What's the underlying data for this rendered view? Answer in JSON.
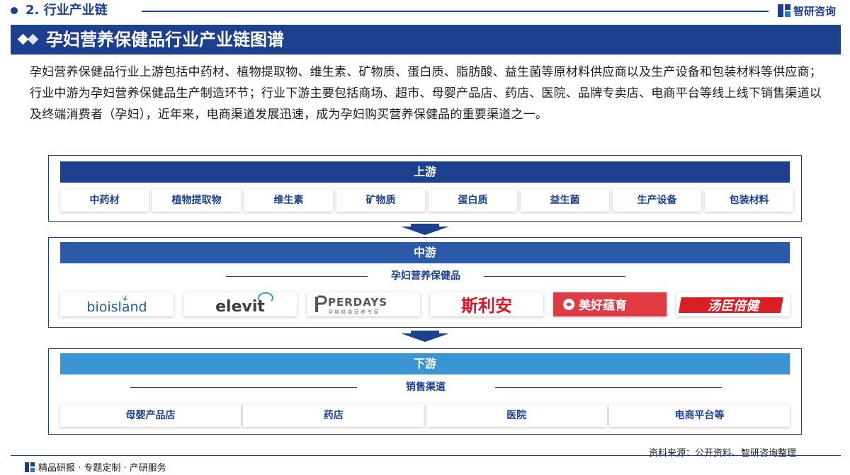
{
  "section": {
    "title": "2. 行业产业链"
  },
  "brand": {
    "name": "智研咨询"
  },
  "title": "孕妇营养保健品行业产业链图谱",
  "intro": "孕妇营养保健品行业上游包括中药材、植物提取物、维生素、矿物质、蛋白质、脂肪酸、益生菌等原材料供应商以及生产设备和包装材料等供应商；行业中游为孕妇营养保健品生产制造环节；行业下游主要包括商场、超市、母婴产品店、药店、医院、品牌专卖店、电商平台等线上线下销售渠道以及终端消费者（孕妇），近年来，电商渠道发展迅速，成为孕妇购买营养保健品的重要渠道之一。",
  "upstream": {
    "label": "上游",
    "items": [
      "中药材",
      "植物提取物",
      "维生素",
      "矿物质",
      "蛋白质",
      "益生菌",
      "生产设备",
      "包装材料"
    ]
  },
  "midstream": {
    "label": "中游",
    "sub_label": "孕妇营养保健品",
    "logos": {
      "bioisland": "bioisland",
      "elevit": "elevit",
      "perdays": "PERDAYS",
      "perdays_sub": "孕 期 精 准 营 养 专 家",
      "siliann": "斯利安",
      "meihao": "美好蕴育",
      "tangchen": "汤臣倍健"
    }
  },
  "downstream": {
    "label": "下游",
    "sub_label": "销售渠道",
    "items": [
      "母婴产品店",
      "药店",
      "医院",
      "电商平台等"
    ]
  },
  "footer": {
    "source": "资料来源：公开资料、智研咨询整理",
    "slogan": "精品研报 · 专题定制 · 产研服务"
  },
  "colors": {
    "primary": "#1c3f8e",
    "mid_band": "#2b5aaa",
    "down_band": "#3b95d2",
    "siliann_red": "#d7182a",
    "meihao_red": "#e03a45"
  }
}
